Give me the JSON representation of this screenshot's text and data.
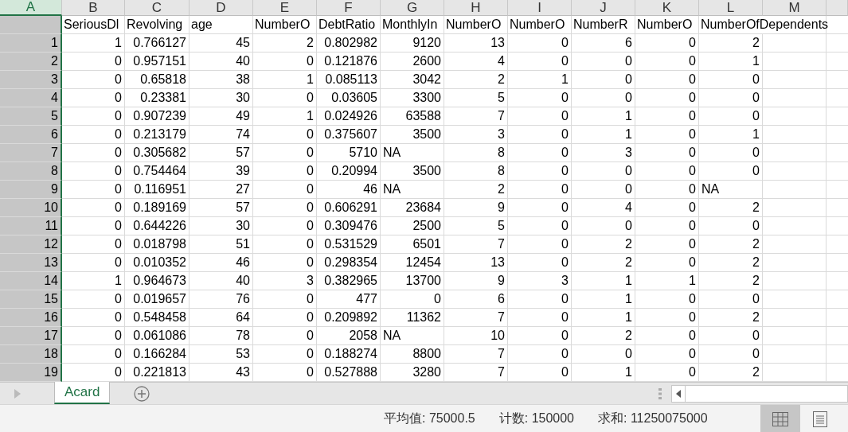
{
  "columns": [
    {
      "letter": "A",
      "selected": true
    },
    {
      "letter": "B",
      "selected": false
    },
    {
      "letter": "C",
      "selected": false
    },
    {
      "letter": "D",
      "selected": false
    },
    {
      "letter": "E",
      "selected": false
    },
    {
      "letter": "F",
      "selected": false
    },
    {
      "letter": "G",
      "selected": false
    },
    {
      "letter": "H",
      "selected": false
    },
    {
      "letter": "I",
      "selected": false
    },
    {
      "letter": "J",
      "selected": false
    },
    {
      "letter": "K",
      "selected": false
    },
    {
      "letter": "L",
      "selected": false
    },
    {
      "letter": "M",
      "selected": false
    }
  ],
  "header_row": [
    "SeriousDl",
    "Revolving",
    "age",
    "NumberO",
    "DebtRatio",
    "MonthlyIn",
    "NumberO",
    "NumberO",
    "NumberR",
    "NumberO",
    "NumberOfDependents"
  ],
  "rows": [
    {
      "index": "1",
      "cells": [
        "1",
        "0.766127",
        "45",
        "2",
        "0.802982",
        "9120",
        "13",
        "0",
        "6",
        "0",
        "2"
      ]
    },
    {
      "index": "2",
      "cells": [
        "0",
        "0.957151",
        "40",
        "0",
        "0.121876",
        "2600",
        "4",
        "0",
        "0",
        "0",
        "1"
      ]
    },
    {
      "index": "3",
      "cells": [
        "0",
        "0.65818",
        "38",
        "1",
        "0.085113",
        "3042",
        "2",
        "1",
        "0",
        "0",
        "0"
      ]
    },
    {
      "index": "4",
      "cells": [
        "0",
        "0.23381",
        "30",
        "0",
        "0.03605",
        "3300",
        "5",
        "0",
        "0",
        "0",
        "0"
      ]
    },
    {
      "index": "5",
      "cells": [
        "0",
        "0.907239",
        "49",
        "1",
        "0.024926",
        "63588",
        "7",
        "0",
        "1",
        "0",
        "0"
      ]
    },
    {
      "index": "6",
      "cells": [
        "0",
        "0.213179",
        "74",
        "0",
        "0.375607",
        "3500",
        "3",
        "0",
        "1",
        "0",
        "1"
      ]
    },
    {
      "index": "7",
      "cells": [
        "0",
        "0.305682",
        "57",
        "0",
        "5710",
        {
          "value": "NA",
          "kind": "text"
        },
        "8",
        "0",
        "3",
        "0",
        "0"
      ]
    },
    {
      "index": "8",
      "cells": [
        "0",
        "0.754464",
        "39",
        "0",
        "0.20994",
        "3500",
        "8",
        "0",
        "0",
        "0",
        "0"
      ]
    },
    {
      "index": "9",
      "cells": [
        "0",
        "0.116951",
        "27",
        "0",
        "46",
        {
          "value": "NA",
          "kind": "text"
        },
        "2",
        "0",
        "0",
        "0",
        {
          "value": "NA",
          "kind": "text"
        }
      ]
    },
    {
      "index": "10",
      "cells": [
        "0",
        "0.189169",
        "57",
        "0",
        "0.606291",
        "23684",
        "9",
        "0",
        "4",
        "0",
        "2"
      ]
    },
    {
      "index": "11",
      "cells": [
        "0",
        "0.644226",
        "30",
        "0",
        "0.309476",
        "2500",
        "5",
        "0",
        "0",
        "0",
        "0"
      ]
    },
    {
      "index": "12",
      "cells": [
        "0",
        "0.018798",
        "51",
        "0",
        "0.531529",
        "6501",
        "7",
        "0",
        "2",
        "0",
        "2"
      ]
    },
    {
      "index": "13",
      "cells": [
        "0",
        "0.010352",
        "46",
        "0",
        "0.298354",
        "12454",
        "13",
        "0",
        "2",
        "0",
        "2"
      ]
    },
    {
      "index": "14",
      "cells": [
        "1",
        "0.964673",
        "40",
        "3",
        "0.382965",
        "13700",
        "9",
        "3",
        "1",
        "1",
        "2"
      ]
    },
    {
      "index": "15",
      "cells": [
        "0",
        "0.019657",
        "76",
        "0",
        "477",
        "0",
        "6",
        "0",
        "1",
        "0",
        "0"
      ]
    },
    {
      "index": "16",
      "cells": [
        "0",
        "0.548458",
        "64",
        "0",
        "0.209892",
        "11362",
        "7",
        "0",
        "1",
        "0",
        "2"
      ]
    },
    {
      "index": "17",
      "cells": [
        "0",
        "0.061086",
        "78",
        "0",
        "2058",
        {
          "value": "NA",
          "kind": "text"
        },
        "10",
        "0",
        "2",
        "0",
        "0"
      ]
    },
    {
      "index": "18",
      "cells": [
        "0",
        "0.166284",
        "53",
        "0",
        "0.188274",
        "8800",
        "7",
        "0",
        "0",
        "0",
        "0"
      ]
    },
    {
      "index": "19",
      "cells": [
        "0",
        "0.221813",
        "43",
        "0",
        "0.527888",
        "3280",
        "7",
        "0",
        "1",
        "0",
        "2"
      ]
    }
  ],
  "sheet_tabs": [
    {
      "label": "Acard",
      "selected": true
    }
  ],
  "status_bar": {
    "items": [
      "平均值: 75000.5",
      "计数: 150000",
      "求和: 11250075000"
    ],
    "views": [
      {
        "kind": "normal",
        "selected": true
      },
      {
        "kind": "page_layout",
        "selected": false
      }
    ]
  }
}
